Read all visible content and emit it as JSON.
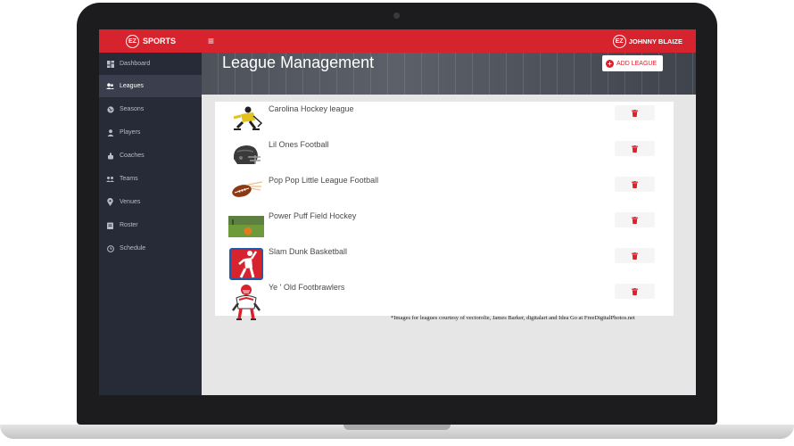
{
  "app": {
    "brand_logo": "EZ",
    "brand_name": "SPORTS"
  },
  "header": {
    "user_logo": "EZ",
    "user_name": "JOHNNY BLAIZE",
    "menu_icon": "hamburger-icon"
  },
  "sidebar": {
    "items": [
      {
        "label": "Dashboard",
        "icon": "dashboard-icon",
        "active": false
      },
      {
        "label": "Leagues",
        "icon": "users-icon",
        "active": true
      },
      {
        "label": "Seasons",
        "icon": "globe-icon",
        "active": false
      },
      {
        "label": "Players",
        "icon": "person-icon",
        "active": false
      },
      {
        "label": "Coaches",
        "icon": "whistle-icon",
        "active": false
      },
      {
        "label": "Teams",
        "icon": "group-icon",
        "active": false
      },
      {
        "label": "Venues",
        "icon": "map-pin-icon",
        "active": false
      },
      {
        "label": "Roster",
        "icon": "clipboard-icon",
        "active": false
      },
      {
        "label": "Schedule",
        "icon": "clock-icon",
        "active": false
      }
    ]
  },
  "page": {
    "title": "League Management",
    "add_button": "ADD LEAGUE"
  },
  "leagues": [
    {
      "name": "Carolina Hockey league",
      "image": "hockey-player-image"
    },
    {
      "name": "Lil Ones Football",
      "image": "football-helmet-image"
    },
    {
      "name": "Pop Pop Little League Football",
      "image": "football-image"
    },
    {
      "name": "Power Puff Field Hockey",
      "image": "field-hockey-image"
    },
    {
      "name": "Slam Dunk Basketball",
      "image": "basketball-player-image"
    },
    {
      "name": "Ye ' Old Footbrawlers",
      "image": "football-player-image"
    }
  ],
  "credit": "*Images for leagues courtesy of vectorolie, James Barker, digitalart and Idea Go at FreeDigitalPhotos.net",
  "colors": {
    "accent": "#d7232d",
    "sidebar": "#272a37",
    "sidebar_active": "#3b3f4d"
  }
}
